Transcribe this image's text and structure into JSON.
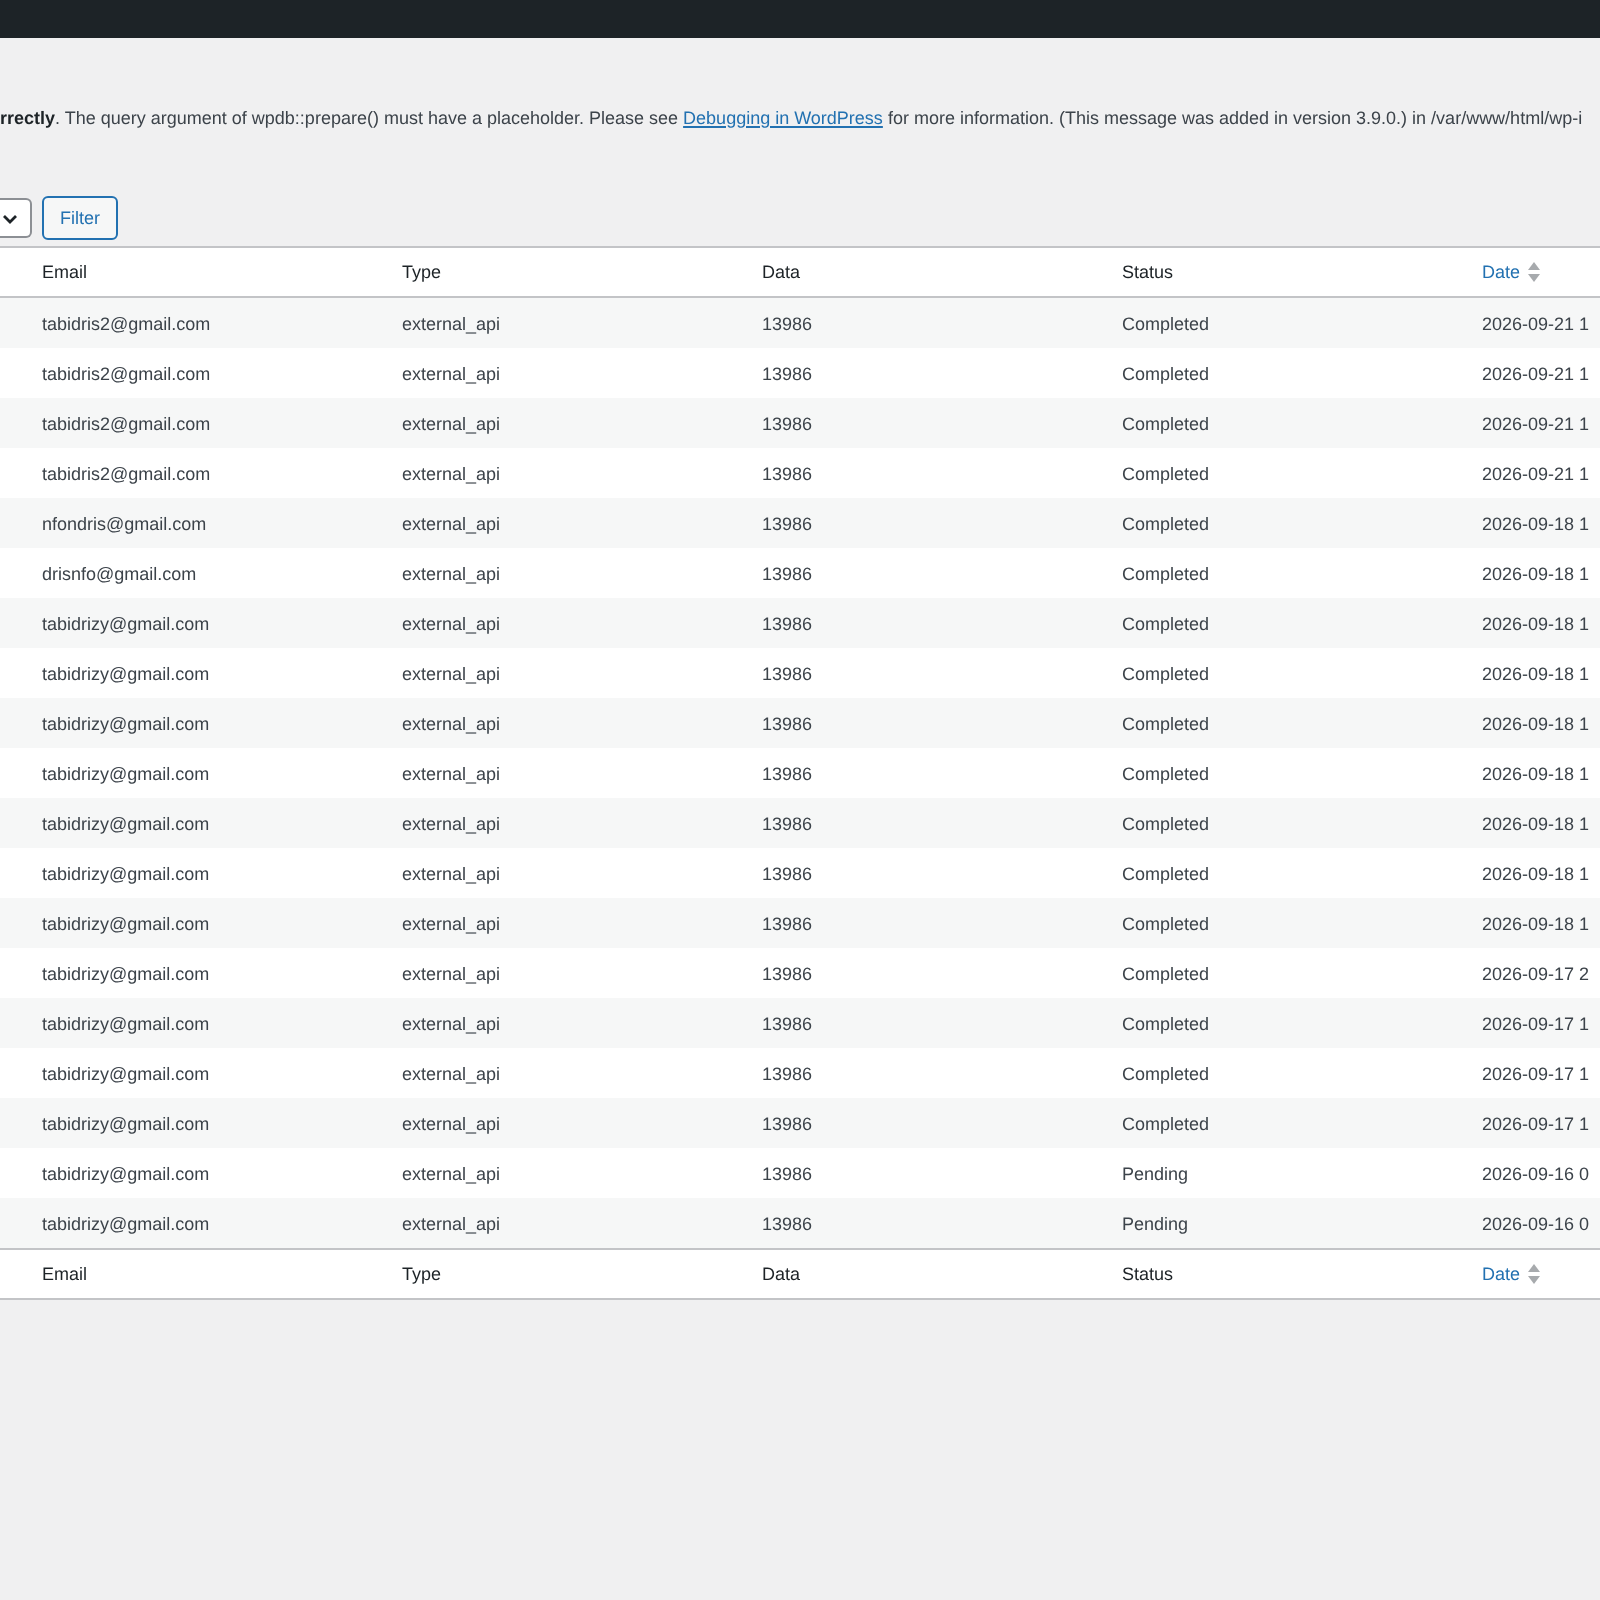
{
  "notice": {
    "lead": "**rrectly**. The query argument of wpdb::prepare() must have a placeholder. Please see ",
    "link": "Debugging in WordPress",
    "tail": " for more information. (This message was added in version 3.9.0.) in /var/www/html/wp-i"
  },
  "filter": {
    "button": "Filter"
  },
  "table": {
    "columns": [
      {
        "label": "Email",
        "sortable": false
      },
      {
        "label": "Type",
        "sortable": false
      },
      {
        "label": "Data",
        "sortable": false
      },
      {
        "label": "Status",
        "sortable": false
      },
      {
        "label": "Date",
        "sortable": true
      }
    ],
    "rows": [
      {
        "email": "tabidris2@gmail.com",
        "type": "external_api",
        "data": "13986",
        "status": "Completed",
        "date": "2026-09-21 1"
      },
      {
        "email": "tabidris2@gmail.com",
        "type": "external_api",
        "data": "13986",
        "status": "Completed",
        "date": "2026-09-21 1"
      },
      {
        "email": "tabidris2@gmail.com",
        "type": "external_api",
        "data": "13986",
        "status": "Completed",
        "date": "2026-09-21 1"
      },
      {
        "email": "tabidris2@gmail.com",
        "type": "external_api",
        "data": "13986",
        "status": "Completed",
        "date": "2026-09-21 1"
      },
      {
        "email": "nfondris@gmail.com",
        "type": "external_api",
        "data": "13986",
        "status": "Completed",
        "date": "2026-09-18 1"
      },
      {
        "email": "drisnfo@gmail.com",
        "type": "external_api",
        "data": "13986",
        "status": "Completed",
        "date": "2026-09-18 1"
      },
      {
        "email": "tabidrizy@gmail.com",
        "type": "external_api",
        "data": "13986",
        "status": "Completed",
        "date": "2026-09-18 1"
      },
      {
        "email": "tabidrizy@gmail.com",
        "type": "external_api",
        "data": "13986",
        "status": "Completed",
        "date": "2026-09-18 1"
      },
      {
        "email": "tabidrizy@gmail.com",
        "type": "external_api",
        "data": "13986",
        "status": "Completed",
        "date": "2026-09-18 1"
      },
      {
        "email": "tabidrizy@gmail.com",
        "type": "external_api",
        "data": "13986",
        "status": "Completed",
        "date": "2026-09-18 1"
      },
      {
        "email": "tabidrizy@gmail.com",
        "type": "external_api",
        "data": "13986",
        "status": "Completed",
        "date": "2026-09-18 1"
      },
      {
        "email": "tabidrizy@gmail.com",
        "type": "external_api",
        "data": "13986",
        "status": "Completed",
        "date": "2026-09-18 1"
      },
      {
        "email": "tabidrizy@gmail.com",
        "type": "external_api",
        "data": "13986",
        "status": "Completed",
        "date": "2026-09-18 1"
      },
      {
        "email": "tabidrizy@gmail.com",
        "type": "external_api",
        "data": "13986",
        "status": "Completed",
        "date": "2026-09-17 2"
      },
      {
        "email": "tabidrizy@gmail.com",
        "type": "external_api",
        "data": "13986",
        "status": "Completed",
        "date": "2026-09-17 1"
      },
      {
        "email": "tabidrizy@gmail.com",
        "type": "external_api",
        "data": "13986",
        "status": "Completed",
        "date": "2026-09-17 1"
      },
      {
        "email": "tabidrizy@gmail.com",
        "type": "external_api",
        "data": "13986",
        "status": "Completed",
        "date": "2026-09-17 1"
      },
      {
        "email": "tabidrizy@gmail.com",
        "type": "external_api",
        "data": "13986",
        "status": "Pending",
        "date": "2026-09-16 0"
      },
      {
        "email": "tabidrizy@gmail.com",
        "type": "external_api",
        "data": "13986",
        "status": "Pending",
        "date": "2026-09-16 0"
      }
    ],
    "footer_columns": [
      {
        "label": "Email",
        "sortable": false
      },
      {
        "label": "Type",
        "sortable": false
      },
      {
        "label": "Data",
        "sortable": false
      },
      {
        "label": "Status",
        "sortable": false
      },
      {
        "label": "Date",
        "sortable": true
      }
    ]
  }
}
